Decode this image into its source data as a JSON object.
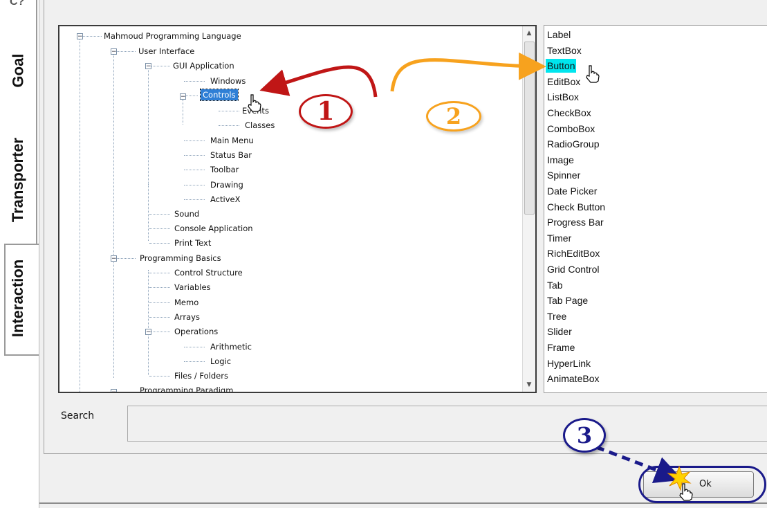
{
  "side_tabs": {
    "top_fragment": "C?",
    "goal": "Goal",
    "transporter": "Transporter",
    "interaction": "Interaction"
  },
  "tree": {
    "root": "Mahmoud Programming Language",
    "user_interface": "User Interface",
    "gui_application": "GUI Application",
    "windows": "Windows",
    "controls": "Controls",
    "events": "Events",
    "classes": "Classes",
    "main_menu": "Main Menu",
    "status_bar": "Status Bar",
    "toolbar": "Toolbar",
    "drawing": "Drawing",
    "activex": "ActiveX",
    "sound": "Sound",
    "console_application": "Console Application",
    "print_text": "Print Text",
    "programming_basics": "Programming Basics",
    "control_structure": "Control Structure",
    "variables": "Variables",
    "memo": "Memo",
    "arrays": "Arrays",
    "operations": "Operations",
    "arithmetic": "Arithmetic",
    "logic": "Logic",
    "files_folders": "Files / Folders",
    "programming_paradigm": "Programming Paradigm"
  },
  "controls_list": {
    "items": [
      "Label",
      "TextBox",
      "Button",
      "EditBox",
      "ListBox",
      "CheckBox",
      "ComboBox",
      "RadioGroup",
      "Image",
      "Spinner",
      "Date Picker",
      "Check Button",
      "Progress Bar",
      "Timer",
      "RichEditBox",
      "Grid Control",
      "Tab",
      "Tab Page",
      "Tree",
      "Slider",
      "Frame",
      "HyperLink",
      "AnimateBox"
    ],
    "selected_index": 2
  },
  "search": {
    "label": "Search",
    "value": ""
  },
  "ok_button": {
    "label": "Ok"
  },
  "annotations": {
    "step1": "1",
    "step2": "2",
    "step3": "3"
  },
  "colors": {
    "step1": "#c01616",
    "step2": "#f7a21e",
    "step3": "#1a1a8a",
    "list_highlight": "#00e5ee",
    "tree_selected": "#2f7fd6"
  }
}
